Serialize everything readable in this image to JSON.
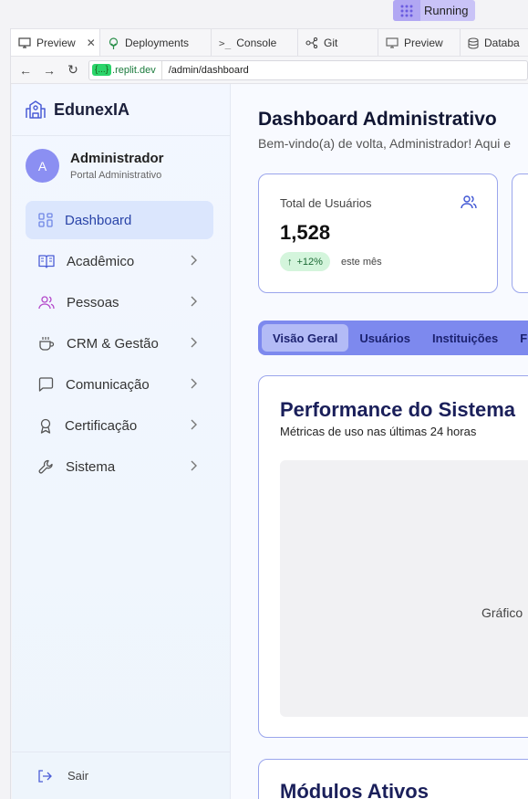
{
  "ide": {
    "status": "Running",
    "tabs": [
      {
        "label": "Preview",
        "icon": "monitor-icon",
        "active": true,
        "closable": true
      },
      {
        "label": "Deployments",
        "icon": "deploy-icon"
      },
      {
        "label": "Console",
        "icon": "terminal-icon"
      },
      {
        "label": "Git",
        "icon": "git-icon"
      },
      {
        "label": "Preview",
        "icon": "monitor-icon"
      },
      {
        "label": "Databa",
        "icon": "database-icon"
      }
    ],
    "url_host_chip": "{...}",
    "url_host": ".replit.dev",
    "url_path": "/admin/dashboard"
  },
  "sidebar": {
    "brand": "EdunexIA",
    "avatar_letter": "A",
    "user_name": "Administrador",
    "user_role": "Portal Administrativo",
    "items": [
      {
        "label": "Dashboard",
        "icon": "grid-icon",
        "active": true
      },
      {
        "label": "Acadêmico",
        "icon": "book-icon"
      },
      {
        "label": "Pessoas",
        "icon": "users-icon"
      },
      {
        "label": "CRM & Gestão",
        "icon": "coffee-icon"
      },
      {
        "label": "Comunicação",
        "icon": "chat-icon"
      },
      {
        "label": "Certificação",
        "icon": "award-icon"
      },
      {
        "label": "Sistema",
        "icon": "wrench-icon"
      }
    ],
    "logout": "Sair"
  },
  "main": {
    "title": "Dashboard Administrativo",
    "subtitle": "Bem-vindo(a) de volta, Administrador! Aqui e",
    "card": {
      "title": "Total de Usuários",
      "value": "1,528",
      "badge": "+12%",
      "note": "este mês"
    },
    "tabs": [
      "Visão Geral",
      "Usuários",
      "Instituições",
      "F"
    ],
    "performance": {
      "title": "Performance do Sistema",
      "subtitle": "Métricas de uso nas últimas 24 horas",
      "placeholder": "Gráfico"
    },
    "modules_title": "Módulos Ativos"
  },
  "colors": {
    "accent": "#7d89ee",
    "brand_avatar": "#8b8ff2",
    "running": "#c9c3f7",
    "success": "#d4f5dc"
  }
}
